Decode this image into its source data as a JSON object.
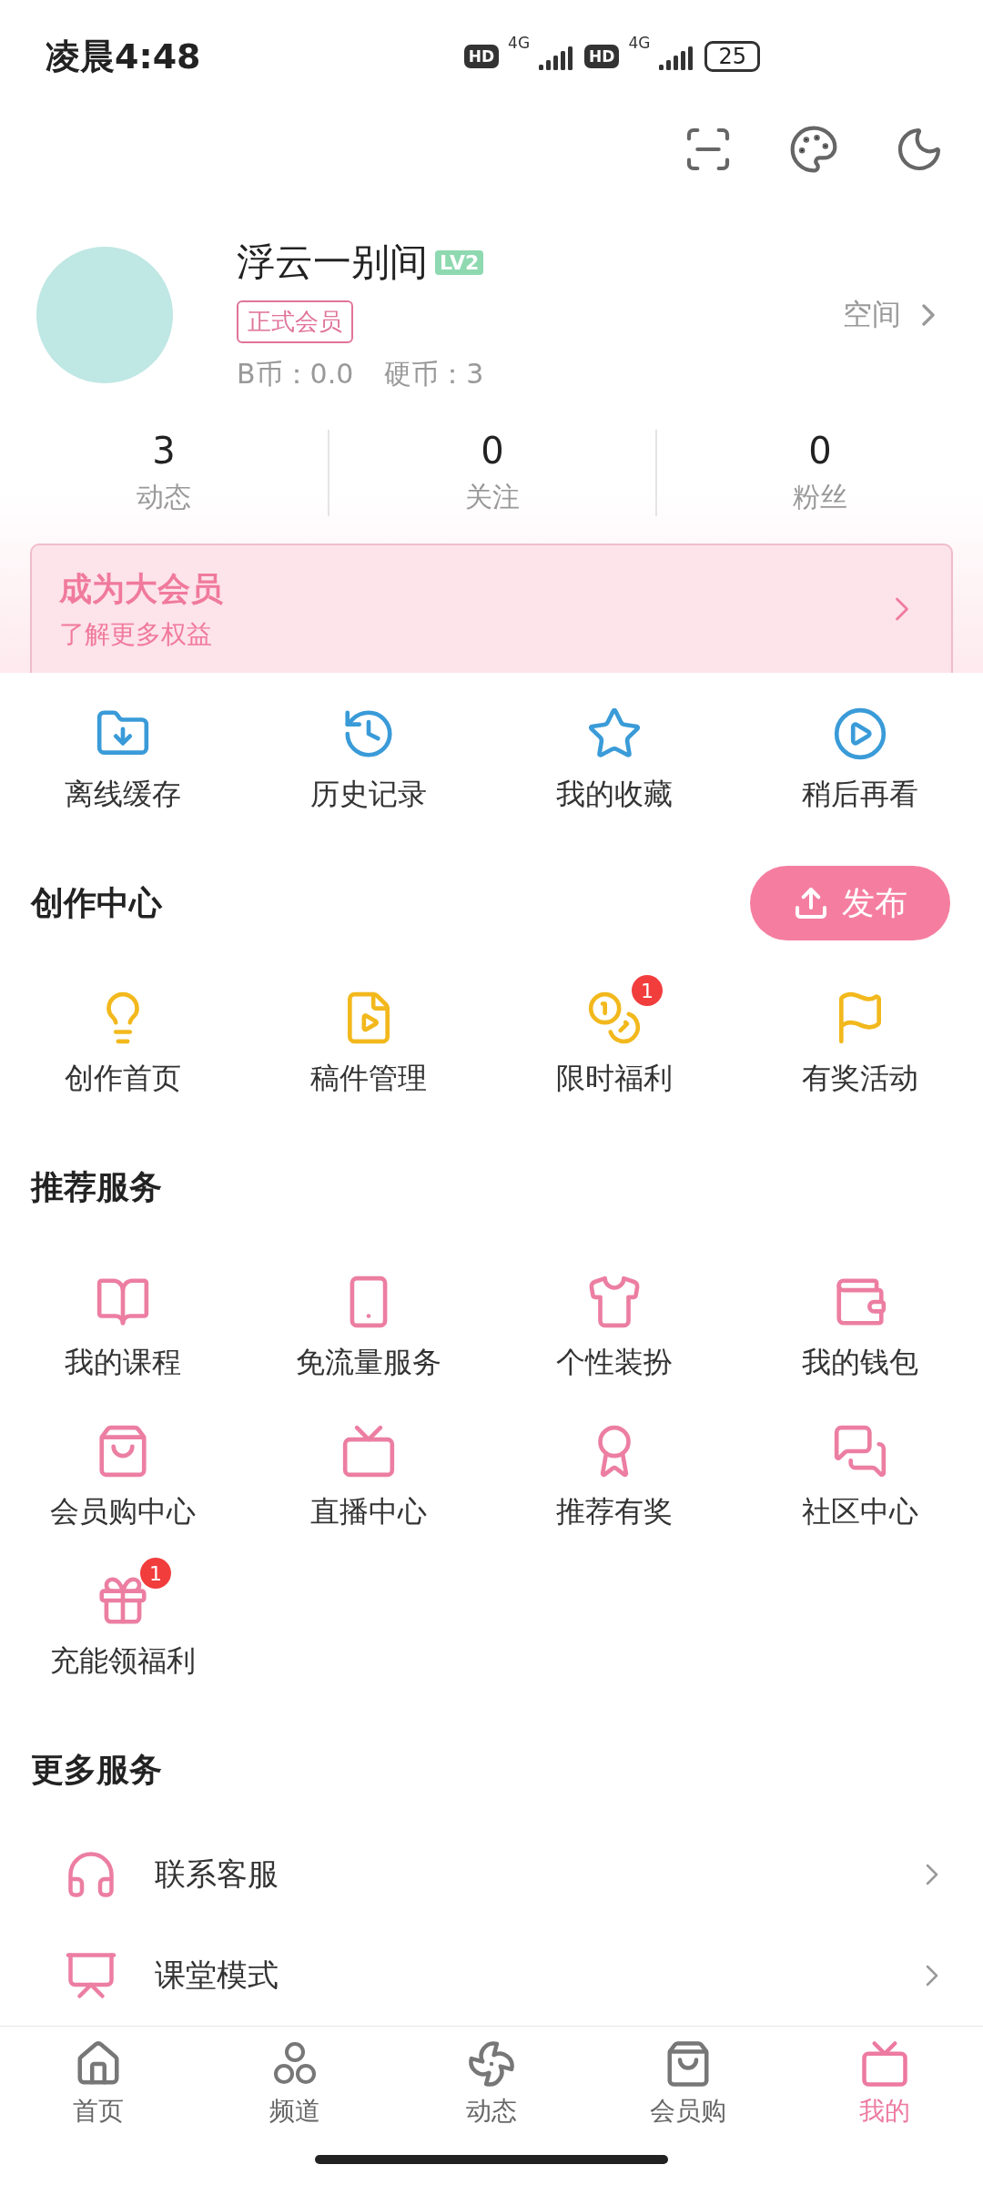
{
  "status_bar": {
    "time": "凌晨4:48",
    "sims": [
      {
        "hd": "HD",
        "network": "4G"
      },
      {
        "hd": "HD",
        "network": "4G"
      }
    ],
    "battery": "25"
  },
  "profile": {
    "name": "浮云一别间",
    "level": "LV2",
    "membership": "正式会员",
    "b_coins": "B币：0.0",
    "coins": "硬币：3",
    "space_link": "空间"
  },
  "stats": [
    {
      "value": "3",
      "label": "动态"
    },
    {
      "value": "0",
      "label": "关注"
    },
    {
      "value": "0",
      "label": "粉丝"
    }
  ],
  "vip_banner": {
    "title": "成为大会员",
    "subtitle": "了解更多权益"
  },
  "quick_actions": [
    {
      "label": "离线缓存"
    },
    {
      "label": "历史记录"
    },
    {
      "label": "我的收藏"
    },
    {
      "label": "稍后再看"
    }
  ],
  "creator_center": {
    "title": "创作中心",
    "publish_button": "发布",
    "items": [
      {
        "label": "创作首页"
      },
      {
        "label": "稿件管理"
      },
      {
        "label": "限时福利",
        "badge": "1"
      },
      {
        "label": "有奖活动"
      }
    ]
  },
  "recommended_services": {
    "title": "推荐服务",
    "items": [
      {
        "label": "我的课程"
      },
      {
        "label": "免流量服务"
      },
      {
        "label": "个性装扮"
      },
      {
        "label": "我的钱包"
      },
      {
        "label": "会员购中心"
      },
      {
        "label": "直播中心"
      },
      {
        "label": "推荐有奖"
      },
      {
        "label": "社区中心"
      },
      {
        "label": "充能领福利",
        "badge": "1"
      }
    ]
  },
  "more_services": {
    "title": "更多服务",
    "items": [
      {
        "label": "联系客服"
      },
      {
        "label": "课堂模式"
      }
    ]
  },
  "bottom_nav": [
    {
      "label": "首页",
      "selected": false
    },
    {
      "label": "频道",
      "selected": false
    },
    {
      "label": "动态",
      "selected": false
    },
    {
      "label": "会员购",
      "selected": false
    },
    {
      "label": "我的",
      "selected": true
    }
  ]
}
